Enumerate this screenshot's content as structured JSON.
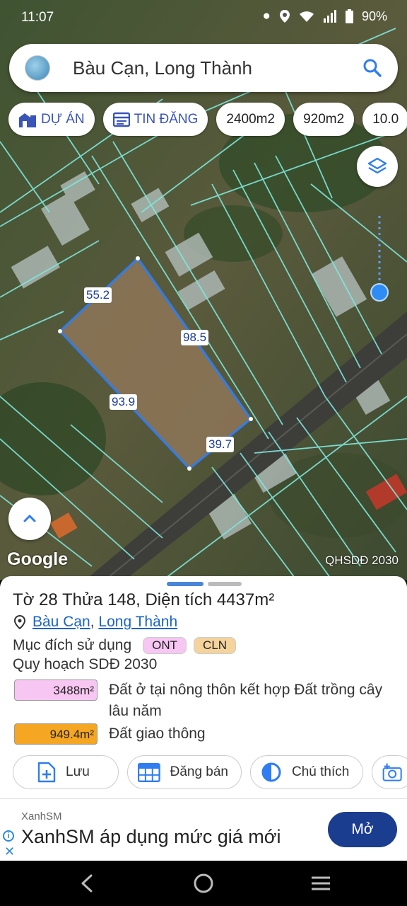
{
  "status": {
    "time": "11:07",
    "battery": "90%"
  },
  "search": {
    "query": "Bàu Cạn, Long Thành"
  },
  "chips": [
    {
      "label": "DỰ ÁN",
      "icon": "building-icon"
    },
    {
      "label": "TIN ĐĂNG",
      "icon": "listing-icon"
    },
    {
      "label": "2400m2"
    },
    {
      "label": "920m2"
    },
    {
      "label": "10.0"
    }
  ],
  "map": {
    "attribution": "Google",
    "layer_label": "QHSDĐ 2030",
    "dimensions": [
      "55.2",
      "98.5",
      "93.9",
      "39.7"
    ]
  },
  "sheet": {
    "title": "Tờ 28 Thửa 148, Diện tích 4437m²",
    "address": {
      "commune": "Bàu Cạn",
      "district": "Long Thành",
      "separator": ","
    },
    "purpose_label": "Mục đích sử dụng",
    "purpose_tags": [
      "ONT",
      "CLN"
    ],
    "plan_label": "Quy hoạch SDĐ 2030",
    "plan_rows": [
      {
        "area": "3488m²",
        "desc": "Đất ở tại nông thôn kết hợp Đất trồng cây lâu năm",
        "color": "#f7c6f2"
      },
      {
        "area": "949.4m²",
        "desc": "Đất giao thông",
        "color": "#f5a623"
      }
    ],
    "actions": [
      {
        "label": "Lưu",
        "icon": "add-file-icon"
      },
      {
        "label": "Đăng bán",
        "icon": "calendar-grid-icon"
      },
      {
        "label": "Chú thích",
        "icon": "half-circle-icon"
      }
    ]
  },
  "ad": {
    "brand": "XanhSM",
    "headline": "XanhSM áp dụng mức giá mới",
    "cta": "Mở"
  },
  "colors": {
    "accent": "#3a55b8",
    "parcel_line": "#2f7df0",
    "ad_cta": "#1b3d8f"
  }
}
